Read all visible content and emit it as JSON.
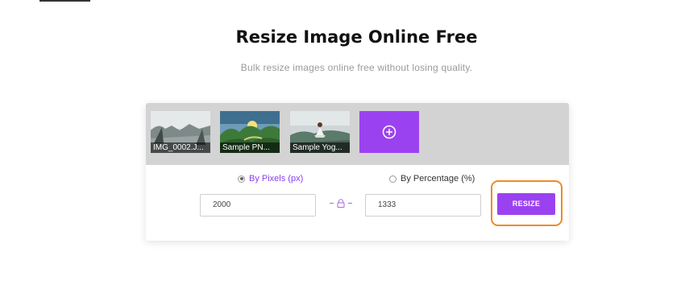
{
  "page": {
    "title": "Resize Image Online Free",
    "subtitle": "Bulk resize images online free without losing quality."
  },
  "thumbnails": [
    {
      "label": "IMG_0002.J..."
    },
    {
      "label": "Sample PN..."
    },
    {
      "label": "Sample Yog..."
    }
  ],
  "add_tile": {
    "icon": "plus-circle-icon"
  },
  "options": {
    "by_pixels_label": "By Pixels (px)",
    "by_percentage_label": "By Percentage (%)",
    "selected": "by_pixels"
  },
  "inputs": {
    "width_value": "2000",
    "height_value": "1333",
    "lock_icon": "lock-icon"
  },
  "actions": {
    "resize_label": "RESIZE"
  },
  "colors": {
    "accent": "#9b42f0",
    "highlight": "#f08a24",
    "strip": "#d3d3d3"
  }
}
